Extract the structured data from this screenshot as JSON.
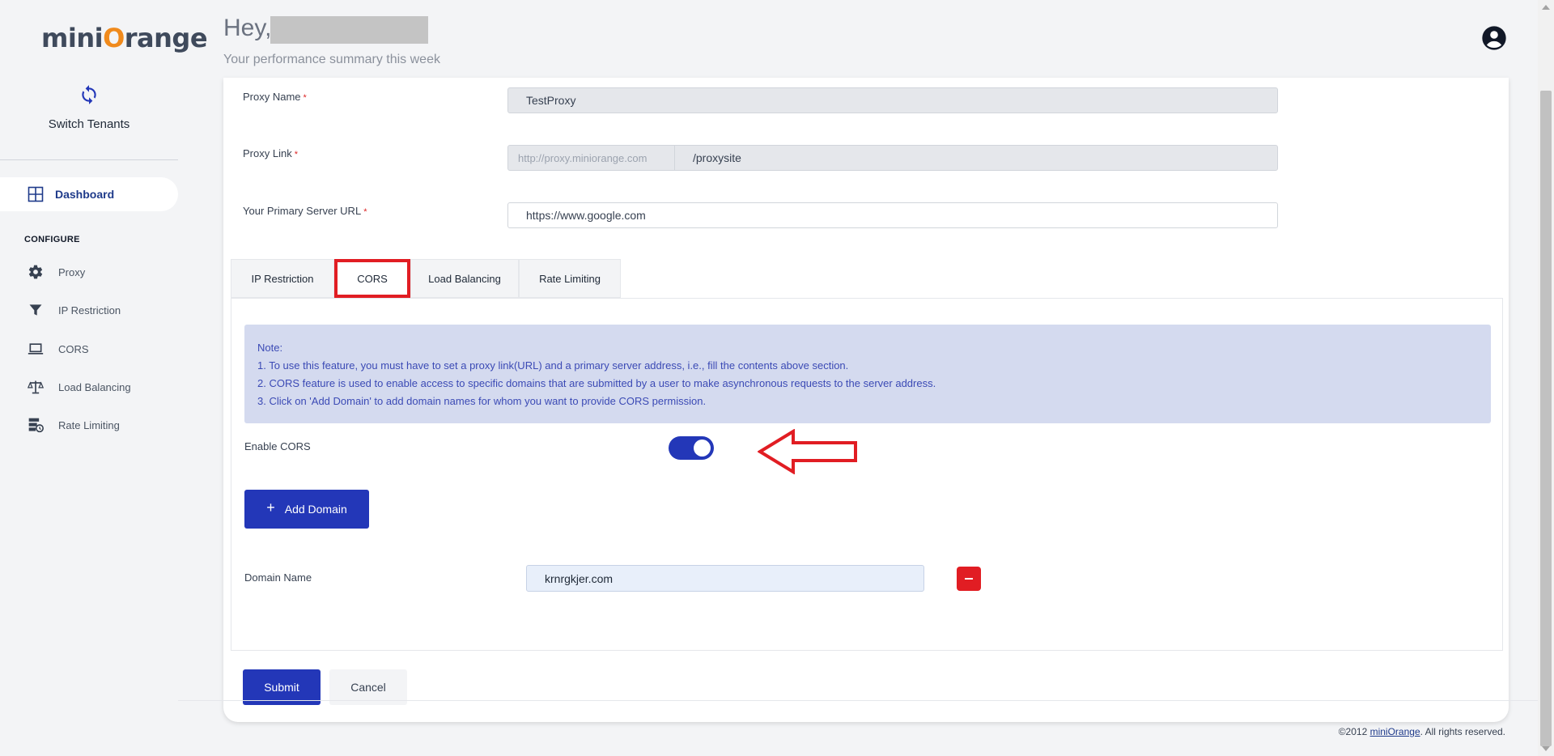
{
  "brand": {
    "logo_pre": "mini",
    "logo_o": "O",
    "logo_post": "range"
  },
  "header": {
    "greeting": "Hey,",
    "subtitle": "Your performance summary this week"
  },
  "sidebar": {
    "switch_label": "Switch Tenants",
    "dashboard": "Dashboard",
    "section": "CONFIGURE",
    "items": [
      {
        "label": "Proxy",
        "icon": "gear-icon"
      },
      {
        "label": "IP Restriction",
        "icon": "filter-icon"
      },
      {
        "label": "CORS",
        "icon": "laptop-icon"
      },
      {
        "label": "Load Balancing",
        "icon": "scale-icon"
      },
      {
        "label": "Rate Limiting",
        "icon": "server-clock-icon"
      }
    ]
  },
  "form": {
    "proxy_name_label": "Proxy Name",
    "proxy_name_value": "TestProxy",
    "proxy_link_label": "Proxy Link",
    "proxy_link_prefix": "http://proxy.miniorange.com",
    "proxy_link_value": "/proxysite",
    "server_url_label": "Your Primary Server URL",
    "server_url_value": "https://www.google.com",
    "required_mark": "*"
  },
  "tabs": [
    {
      "label": "IP Restriction"
    },
    {
      "label": "CORS",
      "active": true
    },
    {
      "label": "Load Balancing"
    },
    {
      "label": "Rate Limiting"
    }
  ],
  "cors": {
    "note_title": "Note:",
    "note_lines": [
      "1. To use this feature, you must have to set a proxy link(URL) and a primary server address, i.e., fill the contents above section.",
      "2. CORS feature is used to enable access to specific domains that are submitted by a user to make asynchronous requests to the server address.",
      "3. Click on 'Add Domain' to add domain names for whom you want to provide CORS permission."
    ],
    "enable_label": "Enable CORS",
    "enabled": true,
    "add_domain": "Add Domain",
    "domain_label": "Domain Name",
    "domain_value": "krnrgkjer.com"
  },
  "actions": {
    "submit": "Submit",
    "cancel": "Cancel"
  },
  "footer": {
    "pre": "©2012 ",
    "link": "miniOrange",
    "post": ". All rights reserved."
  },
  "colors": {
    "primary": "#2337b8",
    "accent_orange": "#f08a1c",
    "danger": "#e11d23",
    "note_bg": "#d4daef"
  }
}
